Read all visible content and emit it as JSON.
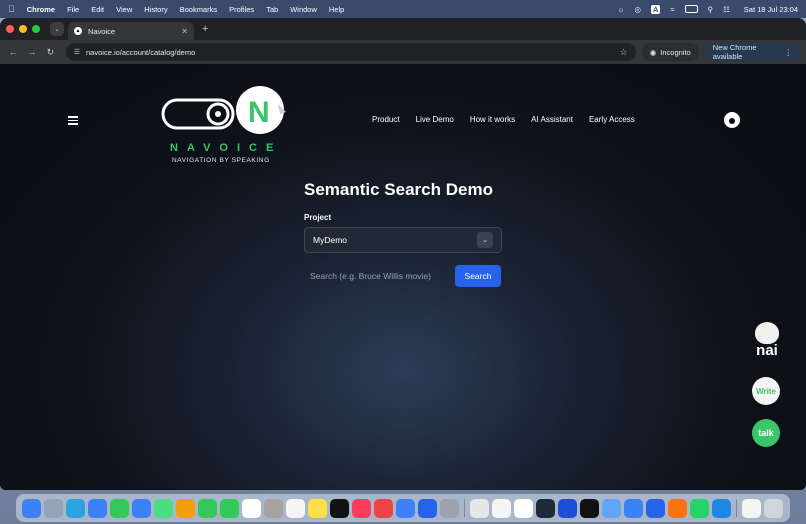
{
  "menubar": {
    "app_name": "Chrome",
    "items": [
      "File",
      "Edit",
      "View",
      "History",
      "Bookmarks",
      "Profiles",
      "Tab",
      "Window",
      "Help"
    ],
    "input_badge": "A",
    "clock": "Sat 18 Jul  23:04"
  },
  "browser": {
    "tab_title": "Navoice",
    "url": "navoice.io/account/catalog/demo",
    "incognito_label": "Incognito",
    "update_label": "New Chrome available"
  },
  "site": {
    "brand_name": "NAVOICE",
    "brand_tagline": "NAVIGATION BY SPEAKING",
    "nav": [
      "Product",
      "Live Demo",
      "How it works",
      "AI Assistant",
      "Early Access"
    ]
  },
  "main": {
    "title": "Semantic Search Demo",
    "project_label": "Project",
    "project_value": "MyDemo",
    "search_placeholder": "Search (e.g. Bruce Willis movie)",
    "search_button": "Search"
  },
  "widgets": {
    "nai_label": "nai",
    "write_label": "Write",
    "talk_label": "talk"
  },
  "colors": {
    "brand_green": "#3cc46a",
    "search_blue": "#2563eb"
  },
  "dock_icons": [
    {
      "name": "finder-icon",
      "color": "#3b82f6"
    },
    {
      "name": "launchpad-icon",
      "color": "#94a3b8"
    },
    {
      "name": "telegram-icon",
      "color": "#2aa3e0"
    },
    {
      "name": "safari-icon",
      "color": "#3b82f6"
    },
    {
      "name": "messages-icon",
      "color": "#34c759"
    },
    {
      "name": "mail-icon",
      "color": "#3b82f6"
    },
    {
      "name": "maps-icon",
      "color": "#4ade80"
    },
    {
      "name": "photos-icon",
      "color": "#f59e0b"
    },
    {
      "name": "facetime-icon",
      "color": "#34c759"
    },
    {
      "name": "phone-icon",
      "color": "#34c759"
    },
    {
      "name": "calendar-icon",
      "color": "#ffffff"
    },
    {
      "name": "contacts-icon",
      "color": "#a8a29e"
    },
    {
      "name": "reminders-icon",
      "color": "#f5f5f5"
    },
    {
      "name": "notes-icon",
      "color": "#fde047"
    },
    {
      "name": "tv-icon",
      "color": "#111111"
    },
    {
      "name": "music-icon",
      "color": "#fb3c5e"
    },
    {
      "name": "testflight-icon",
      "color": "#ef4444"
    },
    {
      "name": "appstore-icon",
      "color": "#3b82f6"
    },
    {
      "name": "pages-icon",
      "color": "#2563eb"
    },
    {
      "name": "settings-icon",
      "color": "#9ca3af"
    },
    {
      "name": "preview-icon",
      "color": "#e5e7eb"
    },
    {
      "name": "chrome-icon",
      "color": "#f5f5f5"
    },
    {
      "name": "chatgpt-icon",
      "color": "#ffffff"
    },
    {
      "name": "terminal-icon",
      "color": "#1f2937"
    },
    {
      "name": "proton-vpn-icon",
      "color": "#1d4ed8"
    },
    {
      "name": "activity-monitor-icon",
      "color": "#111111"
    },
    {
      "name": "diskutility-icon",
      "color": "#60a5fa"
    },
    {
      "name": "proxyman-icon",
      "color": "#3b82f6"
    },
    {
      "name": "xcode-icon",
      "color": "#2563eb"
    },
    {
      "name": "claude-icon",
      "color": "#f97316"
    },
    {
      "name": "whatsapp-icon",
      "color": "#25d366"
    },
    {
      "name": "vscode-icon",
      "color": "#1e88e5"
    },
    {
      "name": "document-icon",
      "color": "#f5f5f5"
    },
    {
      "name": "trash-icon",
      "color": "#d1d5db"
    }
  ]
}
